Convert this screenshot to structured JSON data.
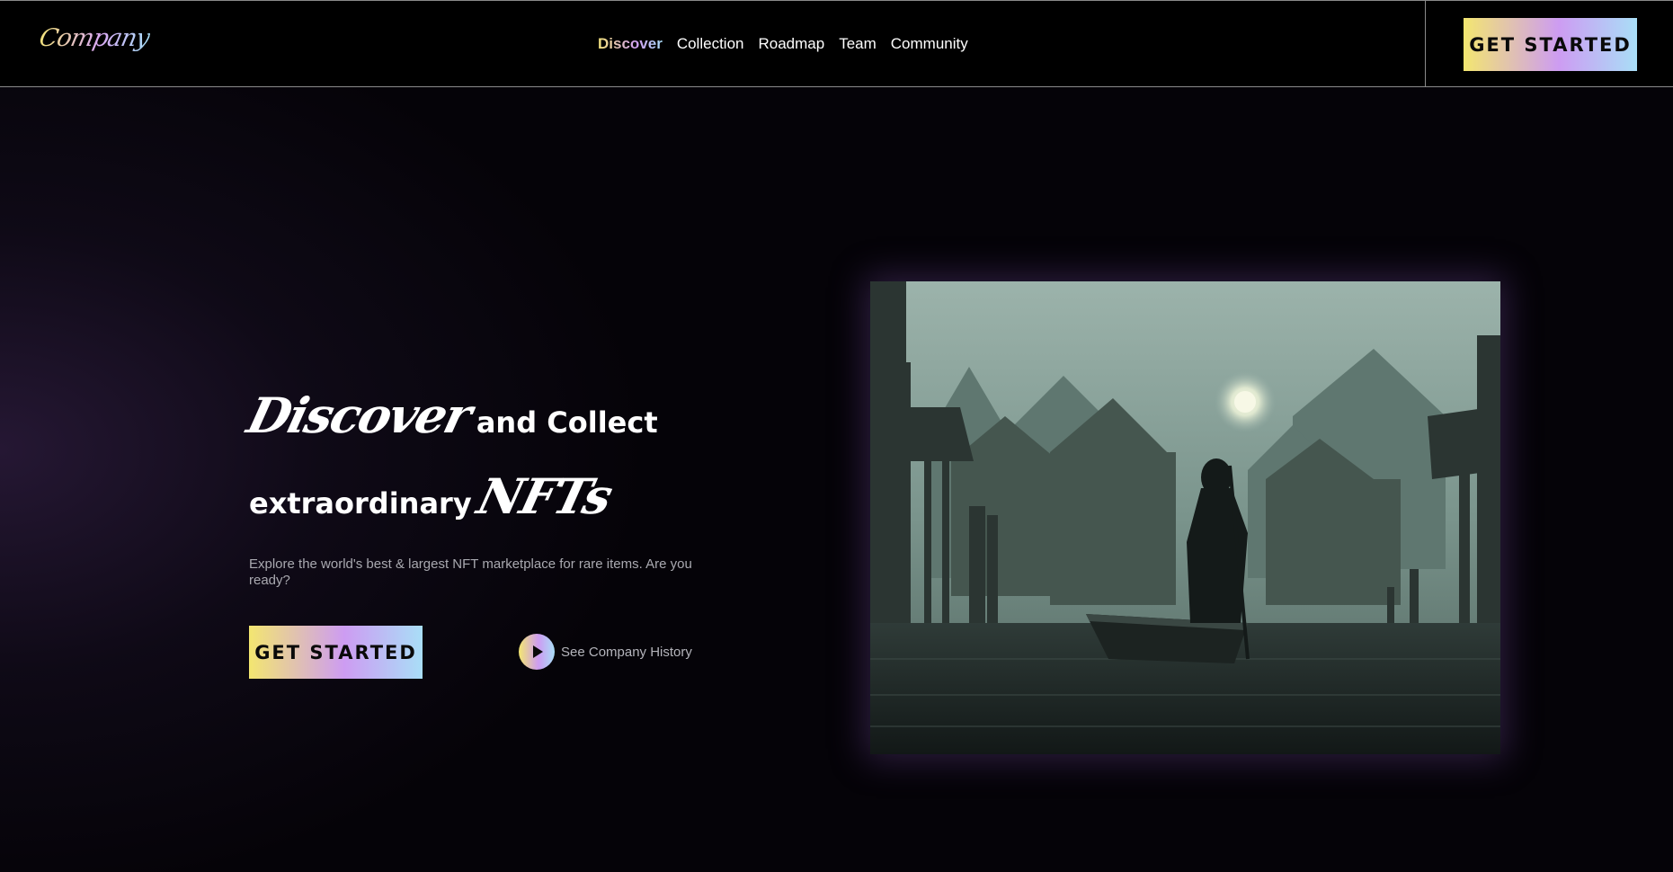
{
  "brand": {
    "logo_text": "Company"
  },
  "nav": {
    "links": [
      {
        "label": "Discover",
        "active": true
      },
      {
        "label": "Collection",
        "active": false
      },
      {
        "label": "Roadmap",
        "active": false
      },
      {
        "label": "Team",
        "active": false
      },
      {
        "label": "Community",
        "active": false
      }
    ],
    "cta_label": "GET STARTED"
  },
  "hero": {
    "title_script_1": "Discover",
    "title_plain_1": "and Collect",
    "title_plain_2": "extraordinary",
    "title_script_2": "NFTs",
    "description": "Explore the world's best & largest NFT marketplace for rare items. Are you ready?",
    "cta_label": "GET STARTED",
    "history_label": "See Company History",
    "history_icon": "play-icon"
  },
  "colors": {
    "background": "#050308",
    "gradient_start": "#f3e670",
    "gradient_mid": "#cd9cf2",
    "gradient_end": "#a9def7"
  }
}
